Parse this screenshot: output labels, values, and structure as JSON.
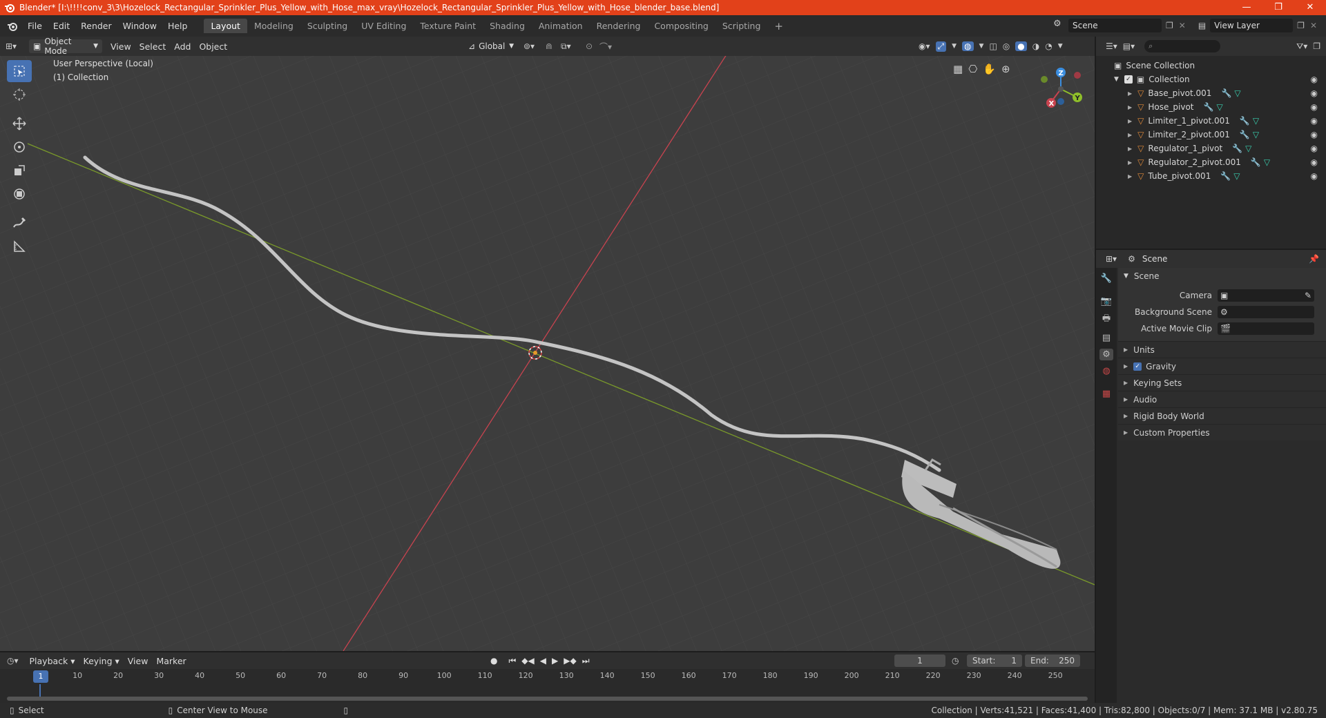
{
  "window": {
    "title": "Blender* [I:\\!!!!conv_3\\3\\Hozelock_Rectangular_Sprinkler_Plus_Yellow_with_Hose_max_vray\\Hozelock_Rectangular_Sprinkler_Plus_Yellow_with_Hose_blender_base.blend]",
    "minimize": "—",
    "maximize": "❐",
    "close": "✕"
  },
  "menu": [
    "File",
    "Edit",
    "Render",
    "Window",
    "Help"
  ],
  "workspaces": [
    "Layout",
    "Modeling",
    "Sculpting",
    "UV Editing",
    "Texture Paint",
    "Shading",
    "Animation",
    "Rendering",
    "Compositing",
    "Scripting"
  ],
  "active_workspace": "Layout",
  "add_workspace": "+",
  "scene_field": "Scene",
  "view_layer_field": "View Layer",
  "viewport_header": {
    "mode": "Object Mode",
    "menus": [
      "View",
      "Select",
      "Add",
      "Object"
    ],
    "orientation": "Global"
  },
  "viewport": {
    "perspective_label": "User Perspective (Local)",
    "collection_label": "(1) Collection",
    "gizmo": {
      "x": "X",
      "y": "Y",
      "z": "Z"
    }
  },
  "outliner": {
    "root": "Scene Collection",
    "collection": "Collection",
    "objects": [
      "Base_pivot.001",
      "Hose_pivot",
      "Limiter_1_pivot.001",
      "Limiter_2_pivot.001",
      "Regulator_1_pivot",
      "Regulator_2_pivot.001",
      "Tube_pivot.001"
    ]
  },
  "properties": {
    "header": "Scene",
    "panel": "Scene",
    "fields": [
      {
        "label": "Camera"
      },
      {
        "label": "Background Scene"
      },
      {
        "label": "Active Movie Clip"
      }
    ],
    "subpanels": [
      "Units",
      "Gravity",
      "Keying Sets",
      "Audio",
      "Rigid Body World",
      "Custom Properties"
    ],
    "gravity_checked": true
  },
  "timeline": {
    "menus": [
      "Playback",
      "Keying",
      "View",
      "Marker"
    ],
    "current_frame": "1",
    "start_label": "Start:",
    "start": "1",
    "end_label": "End:",
    "end": "250",
    "ticks": [
      "1",
      "10",
      "20",
      "30",
      "40",
      "50",
      "60",
      "70",
      "80",
      "90",
      "100",
      "110",
      "120",
      "130",
      "140",
      "150",
      "160",
      "170",
      "180",
      "190",
      "200",
      "210",
      "220",
      "230",
      "240",
      "250"
    ]
  },
  "status": {
    "left_action": "Select",
    "middle_action": "Center View to Mouse",
    "stats": "Collection | Verts:41,521 | Faces:41,400 | Tris:82,800 | Objects:0/7 | Mem: 37.1 MB | v2.80.75"
  },
  "colors": {
    "title_bar": "#e2411a",
    "accent_blue": "#4772b3",
    "x_axis": "#c8434f",
    "y_axis": "#7a9a2a",
    "z_axis": "#3b8ee0",
    "object_icon": "#e08a3a"
  }
}
